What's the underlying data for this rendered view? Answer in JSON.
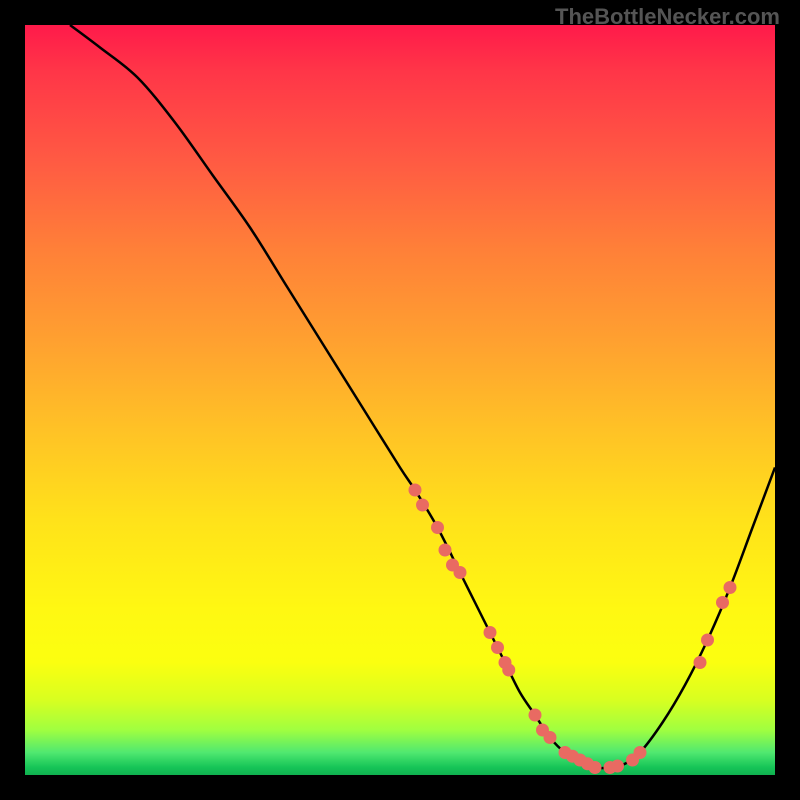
{
  "watermark": "TheBottleNecker.com",
  "chart_data": {
    "type": "line",
    "title": "",
    "xlabel": "",
    "ylabel": "",
    "xlim": [
      0,
      100
    ],
    "ylim": [
      0,
      100
    ],
    "curve": {
      "x": [
        6,
        10,
        15,
        20,
        25,
        30,
        35,
        40,
        45,
        50,
        52,
        55,
        58,
        60,
        62,
        64,
        66,
        68,
        70,
        72,
        74,
        76,
        78,
        80,
        82,
        85,
        88,
        91,
        94,
        97,
        100
      ],
      "y": [
        100,
        97,
        93,
        87,
        80,
        73,
        65,
        57,
        49,
        41,
        38,
        33,
        27,
        23,
        19,
        15,
        11,
        8,
        5,
        3,
        2,
        1,
        1,
        1.5,
        3,
        7,
        12,
        18,
        25,
        33,
        41
      ]
    },
    "markers": [
      {
        "x": 52,
        "y": 38
      },
      {
        "x": 53,
        "y": 36
      },
      {
        "x": 55,
        "y": 33
      },
      {
        "x": 56,
        "y": 30
      },
      {
        "x": 57,
        "y": 28
      },
      {
        "x": 58,
        "y": 27
      },
      {
        "x": 62,
        "y": 19
      },
      {
        "x": 63,
        "y": 17
      },
      {
        "x": 64,
        "y": 15
      },
      {
        "x": 64.5,
        "y": 14
      },
      {
        "x": 68,
        "y": 8
      },
      {
        "x": 69,
        "y": 6
      },
      {
        "x": 70,
        "y": 5
      },
      {
        "x": 72,
        "y": 3
      },
      {
        "x": 73,
        "y": 2.5
      },
      {
        "x": 74,
        "y": 2
      },
      {
        "x": 75,
        "y": 1.5
      },
      {
        "x": 76,
        "y": 1
      },
      {
        "x": 78,
        "y": 1
      },
      {
        "x": 79,
        "y": 1.2
      },
      {
        "x": 81,
        "y": 2
      },
      {
        "x": 82,
        "y": 3
      },
      {
        "x": 90,
        "y": 15
      },
      {
        "x": 91,
        "y": 18
      },
      {
        "x": 93,
        "y": 23
      },
      {
        "x": 94,
        "y": 25
      }
    ]
  }
}
